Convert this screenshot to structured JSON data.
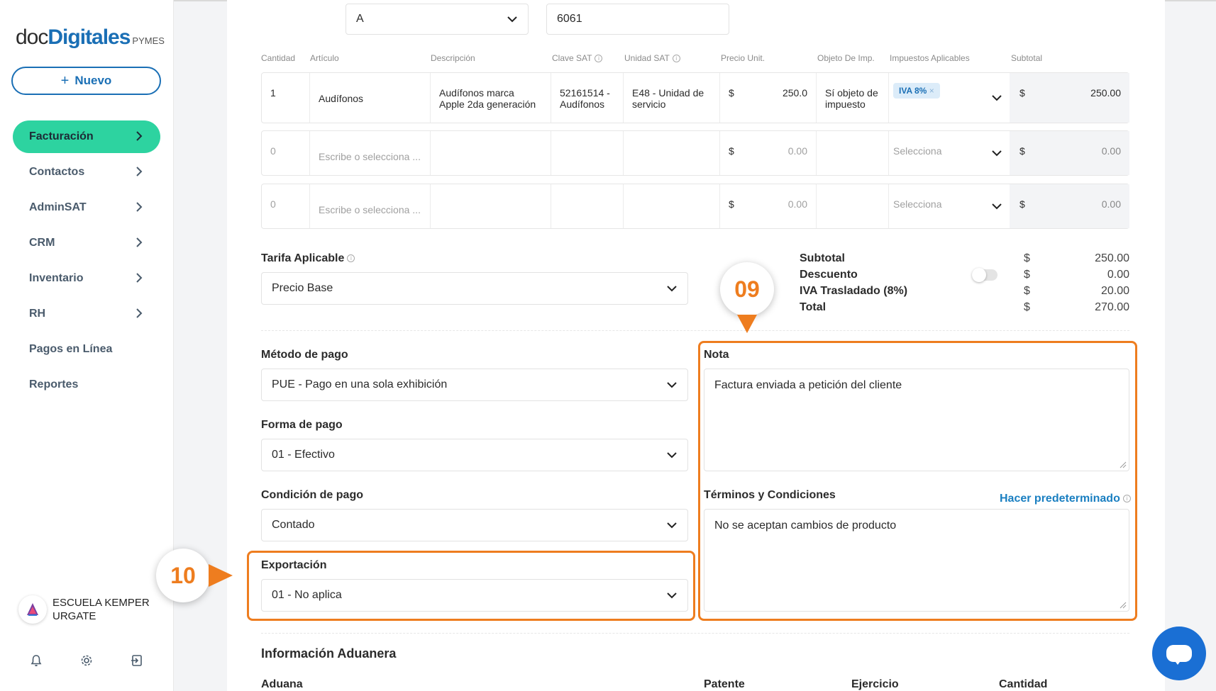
{
  "app": {
    "logo_doc": "doc",
    "logo_digitales": "Digitales",
    "logo_pymes": "PYMES",
    "new_button": "Nuevo"
  },
  "sidebar": {
    "items": [
      {
        "label": "Facturación",
        "active": true,
        "chevron": true
      },
      {
        "label": "Contactos",
        "chevron": true
      },
      {
        "label": "AdminSAT",
        "chevron": true
      },
      {
        "label": "CRM",
        "chevron": true
      },
      {
        "label": "Inventario",
        "chevron": true
      },
      {
        "label": "RH",
        "chevron": true
      },
      {
        "label": "Pagos en Línea",
        "chevron": false
      },
      {
        "label": "Reportes",
        "chevron": false
      }
    ],
    "user": {
      "name_line1": "ESCUELA KEMPER",
      "name_line2": "URGATE"
    },
    "icons": [
      "bell-icon",
      "gear-icon",
      "logout-icon"
    ]
  },
  "top_fields": {
    "serie": "A",
    "folio": "6061"
  },
  "table": {
    "headers": [
      "Cantidad",
      "Artículo",
      "Descripción",
      "Clave SAT",
      "Unidad SAT",
      "Precio Unit.",
      "Objeto De Imp.",
      "Impuestos Aplicables",
      "Subtotal"
    ],
    "rows": [
      {
        "cantidad": "1",
        "articulo": "Audífonos",
        "descripcion_1": "Audífonos marca",
        "descripcion_2": "Apple 2da generación",
        "clave_1": "52161514 -",
        "clave_2": "Audífonos",
        "unidad_1": "E48 - Unidad de",
        "unidad_2": "servicio",
        "currency": "$",
        "precio": "250.0",
        "objeto_1": "Sí objeto de",
        "objeto_2": "impuesto",
        "impuesto": "IVA 8%",
        "subtotal": "250.00"
      },
      {
        "cantidad": "0",
        "articulo": "Escribe o selecciona ...",
        "precio": "0.00",
        "currency": "$",
        "impuesto": "Selecciona",
        "subtotal": "0.00"
      },
      {
        "cantidad": "0",
        "articulo": "Escribe o selecciona ...",
        "precio": "0.00",
        "currency": "$",
        "impuesto": "Selecciona",
        "subtotal": "0.00"
      }
    ]
  },
  "tarifa": {
    "label": "Tarifa Aplicable",
    "value": "Precio Base"
  },
  "totals": {
    "subtotal_label": "Subtotal",
    "subtotal_value": "250.00",
    "descuento_label": "Descuento",
    "descuento_value": "0.00",
    "iva_label": "IVA Trasladado (8%)",
    "iva_value": "20.00",
    "total_label": "Total",
    "total_value": "270.00",
    "currency": "$"
  },
  "payment": {
    "metodo_label": "Método de pago",
    "metodo_value": "PUE - Pago en una sola exhibición",
    "forma_label": "Forma de pago",
    "forma_value": "01 - Efectivo",
    "condicion_label": "Condición de pago",
    "condicion_value": "Contado",
    "exportacion_label": "Exportación",
    "exportacion_value": "01 - No aplica"
  },
  "nota": {
    "label": "Nota",
    "value": "Factura enviada a petición del cliente"
  },
  "terminos": {
    "label": "Términos y Condiciones",
    "link": "Hacer predeterminado",
    "value": "No se aceptan cambios de producto"
  },
  "aduanera": {
    "title": "Información Aduanera",
    "cols": [
      "Aduana",
      "Patente",
      "Ejercicio",
      "Cantidad"
    ]
  },
  "callouts": {
    "c09": "09",
    "c10": "10"
  },
  "colors": {
    "accent_green": "#2dd3a0",
    "brand_blue": "#1a6fb5",
    "callout_orange": "#ee7d1f"
  }
}
